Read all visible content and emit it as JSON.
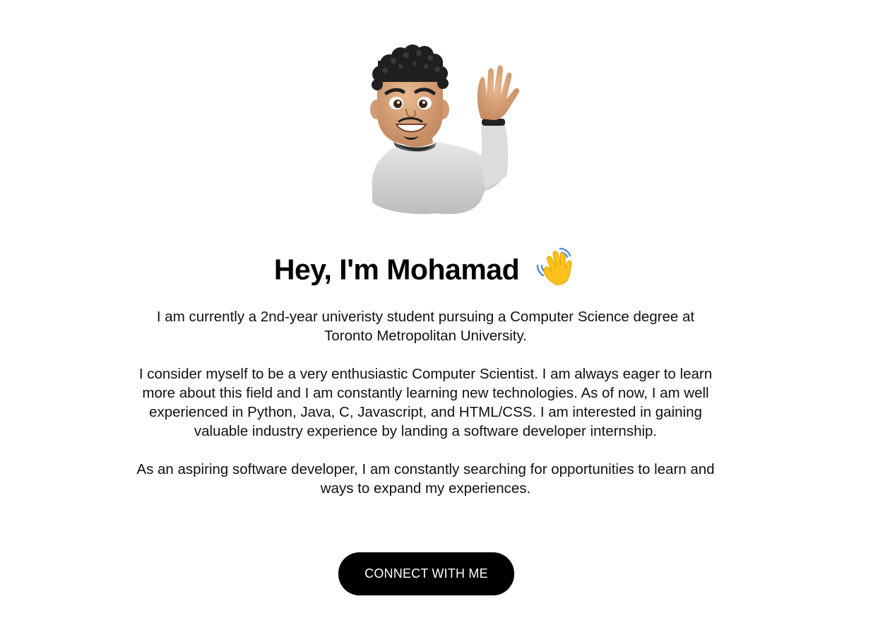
{
  "hero": {
    "avatar_icon": "memoji-waving-avatar",
    "headline": "Hey, I'm Mohamad",
    "headline_icon": "waving-hand-icon"
  },
  "bio": {
    "paragraphs": [
      "I am currently a 2nd-year univeristy student pursuing a Computer Science degree at Toronto Metropolitan University.",
      "I consider myself to be a very enthusiastic Computer Scientist. I am always eager to learn more about this field and I am constantly learning new technologies. As of now, I am well experienced in Python, Java, C, Javascript, and HTML/CSS. I am interested in gaining valuable industry experience by landing a software developer internship.",
      "As an aspiring software developer, I am constantly searching for opportunities to learn and ways to expand my experiences."
    ]
  },
  "cta": {
    "label": "CONNECT WITH ME"
  },
  "colors": {
    "background": "#ffffff",
    "text": "#111111",
    "button_bg": "#000000",
    "button_text": "#ffffff"
  }
}
